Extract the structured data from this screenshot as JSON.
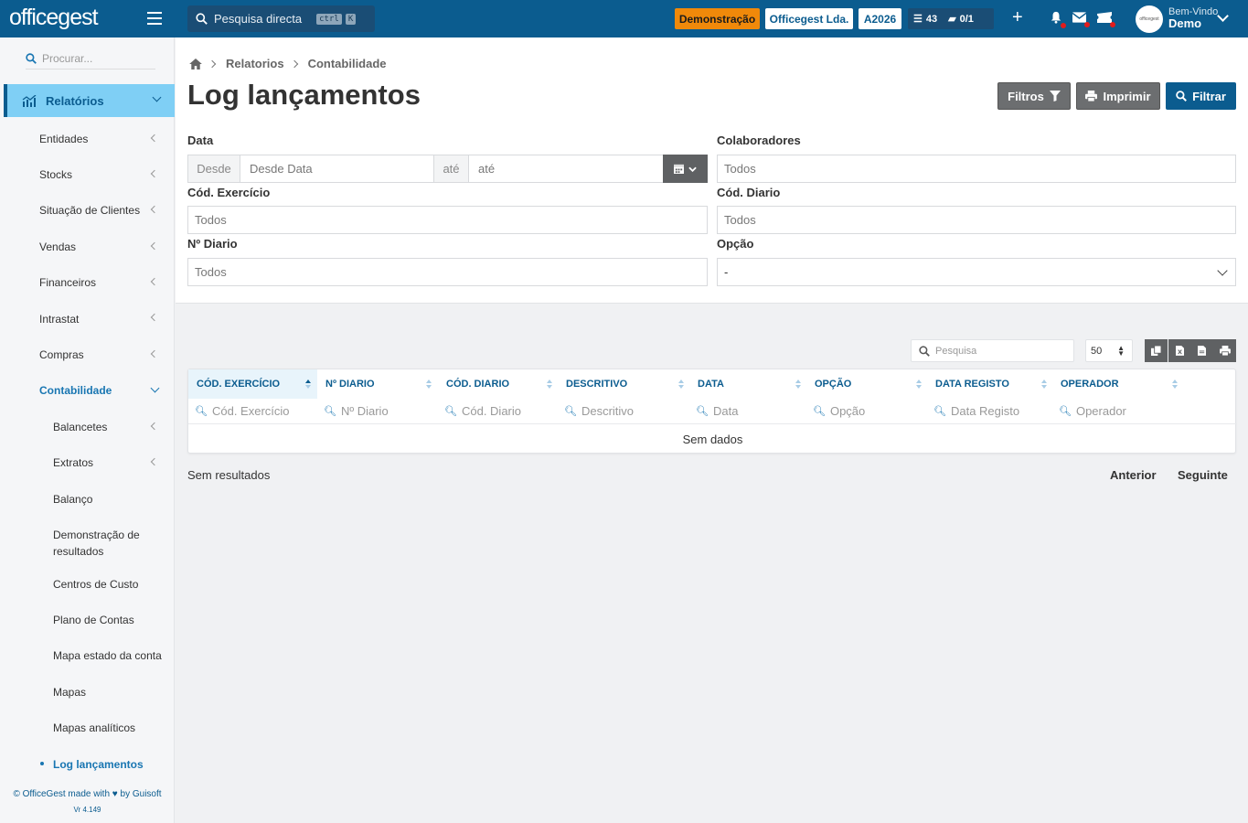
{
  "topbar": {
    "logo": "officegest",
    "search_placeholder": "Pesquisa directa",
    "kbd1": "ctrl",
    "kbd2": "K",
    "demo_badge": "Demonstração",
    "company": "Officegest Lda.",
    "year": "A2026",
    "tasks_count": "43",
    "docs_count": "0/1",
    "welcome": "Bem-Vindo",
    "user": "Demo",
    "accent": "#0b5c8f",
    "demo_color": "#f0890a"
  },
  "sidebar": {
    "search_placeholder": "Procurar...",
    "active_section": "Relatórios",
    "items": [
      {
        "label": "Entidades"
      },
      {
        "label": "Stocks"
      },
      {
        "label": "Situação de Clientes"
      },
      {
        "label": "Vendas"
      },
      {
        "label": "Financeiros"
      },
      {
        "label": "Intrastat"
      },
      {
        "label": "Compras"
      },
      {
        "label": "Contabilidade"
      }
    ],
    "sub_items": [
      {
        "label": "Balancetes"
      },
      {
        "label": "Extratos"
      },
      {
        "label": "Balanço"
      },
      {
        "label": "Demonstração de resultados"
      },
      {
        "label": "Centros de Custo"
      },
      {
        "label": "Plano de Contas"
      },
      {
        "label": "Mapa estado da conta"
      },
      {
        "label": "Mapas"
      },
      {
        "label": "Mapas analíticos"
      },
      {
        "label": "Log lançamentos"
      }
    ],
    "footer_line1": "© OfficeGest made with",
    "footer_line1_by": "by Guisoft",
    "footer_version": "Vr 4.149"
  },
  "breadcrumb": [
    "Relatorios",
    "Contabilidade"
  ],
  "page": {
    "title": "Log lançamentos",
    "btn_filtros": "Filtros",
    "btn_imprimir": "Imprimir",
    "btn_filtrar": "Filtrar"
  },
  "filters": {
    "data_label": "Data",
    "desde_addon": "Desde",
    "desde_placeholder": "Desde Data",
    "ate_addon": "até",
    "ate_placeholder": "até",
    "colaboradores_label": "Colaboradores",
    "colaboradores_value": "Todos",
    "cod_exercicio_label": "Cód. Exercício",
    "cod_exercicio_value": "Todos",
    "cod_diario_label": "Cód. Diario",
    "cod_diario_value": "Todos",
    "n_diario_label": "Nº Diario",
    "n_diario_value": "Todos",
    "opcao_label": "Opção",
    "opcao_value": "-"
  },
  "table": {
    "search_placeholder": "Pesquisa",
    "per_page": "50",
    "columns": [
      {
        "header": "CÓD. EXERCÍCIO",
        "filter": "Cód. Exercício"
      },
      {
        "header": "Nº DIARIO",
        "filter": "Nº Diario"
      },
      {
        "header": "CÓD. DIARIO",
        "filter": "Cód. Diario"
      },
      {
        "header": "DESCRITIVO",
        "filter": "Descritivo"
      },
      {
        "header": "DATA",
        "filter": "Data"
      },
      {
        "header": "OPÇÃO",
        "filter": "Opção"
      },
      {
        "header": "DATA REGISTO",
        "filter": "Data Registo"
      },
      {
        "header": "OPERADOR",
        "filter": "Operador"
      }
    ],
    "empty_text": "Sem dados",
    "results_text": "Sem resultados",
    "prev": "Anterior",
    "next": "Seguinte"
  }
}
